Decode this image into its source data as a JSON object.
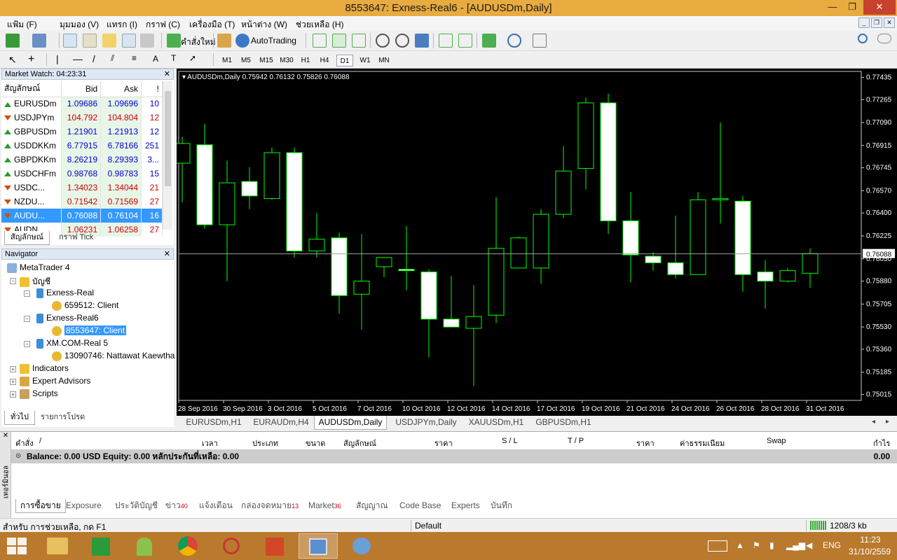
{
  "window": {
    "title": "8553647: Exness-Real6 - [AUDUSDm,Daily]",
    "min_glyph": "—",
    "max_glyph": "❐",
    "close_glyph": "✕"
  },
  "menu": [
    "แฟ้ม (F)",
    "มุมมอง (V)",
    "แทรก (I)",
    "กราฟ (C)",
    "เครื่องมือ (T)",
    "หน้าต่าง (W)",
    "ช่วยเหลือ (H)"
  ],
  "toolbar": {
    "new_order_label": "คำสั่งใหม่",
    "autotrading_label": "AutoTrading"
  },
  "timeframes": [
    "M1",
    "M5",
    "M15",
    "M30",
    "H1",
    "H4",
    "D1",
    "W1",
    "MN"
  ],
  "active_timeframe": "D1",
  "market_watch": {
    "title": "Market Watch: 04:23:31",
    "headers": {
      "symbol": "สัญลักษณ์",
      "bid": "Bid",
      "ask": "Ask",
      "spread": "!"
    },
    "rows": [
      {
        "symbol": "EURUSDm",
        "bid": "1.09686",
        "ask": "1.09696",
        "spread": "10",
        "dir": "up",
        "color": "blue"
      },
      {
        "symbol": "USDJPYm",
        "bid": "104.792",
        "ask": "104.804",
        "spread": "12",
        "dir": "down",
        "color": "red"
      },
      {
        "symbol": "GBPUSDm",
        "bid": "1.21901",
        "ask": "1.21913",
        "spread": "12",
        "dir": "up",
        "color": "blue"
      },
      {
        "symbol": "USDDKKm",
        "bid": "6.77915",
        "ask": "6.78166",
        "spread": "251",
        "dir": "up",
        "color": "blue"
      },
      {
        "symbol": "GBPDKKm",
        "bid": "8.26219",
        "ask": "8.29393",
        "spread": "3...",
        "dir": "up",
        "color": "blue"
      },
      {
        "symbol": "USDCHFm",
        "bid": "0.98768",
        "ask": "0.98783",
        "spread": "15",
        "dir": "up",
        "color": "blue"
      },
      {
        "symbol": "USDC...",
        "bid": "1.34023",
        "ask": "1.34044",
        "spread": "21",
        "dir": "down",
        "color": "red"
      },
      {
        "symbol": "NZDU...",
        "bid": "0.71542",
        "ask": "0.71569",
        "spread": "27",
        "dir": "down",
        "color": "red"
      },
      {
        "symbol": "AUDU...",
        "bid": "0.76088",
        "ask": "0.76104",
        "spread": "16",
        "dir": "down",
        "color": "blue",
        "selected": true
      },
      {
        "symbol": "AUDN...",
        "bid": "1.06231",
        "ask": "1.06258",
        "spread": "27",
        "dir": "down",
        "color": "red"
      }
    ],
    "tabs": [
      "สัญลักษณ์",
      "กราฟ Tick"
    ]
  },
  "navigator": {
    "title": "Navigator",
    "root": "MetaTrader 4",
    "accounts_label": "บัญชี",
    "servers": [
      {
        "name": "Exness-Real",
        "client": "659512: Client"
      },
      {
        "name": "Exness-Real6",
        "client": "8553647: Client"
      },
      {
        "name": "XM.COM-Real 5",
        "client": "13090746: Nattawat Kaewtha"
      }
    ],
    "indicators": "Indicators",
    "experts": "Expert Advisors",
    "scripts": "Scripts",
    "tabs": [
      "ทั่วไป",
      "รายการโปรด"
    ]
  },
  "chart_tabs": [
    "EURUSDm,H1",
    "EURAUDm,H4",
    "AUDUSDm,Daily",
    "USDJPYm,Daily",
    "XAUUSDm,H1",
    "GBPUSDm,H1"
  ],
  "active_chart_tab": 2,
  "chart_data": {
    "type": "candlestick",
    "symbol_label": "AUDUSDm,Daily",
    "ohlc_label": "0.75942 0.76132 0.75826 0.76088",
    "price_ticks": [
      "0.77435",
      "0.77265",
      "0.77090",
      "0.76915",
      "0.76745",
      "0.76570",
      "0.76400",
      "0.76225",
      "0.76050",
      "0.75880",
      "0.75705",
      "0.75530",
      "0.75360",
      "0.75185",
      "0.75015"
    ],
    "current_price": "0.76088",
    "date_labels": [
      "28 Sep 2016",
      "30 Sep 2016",
      "3 Oct 2016",
      "5 Oct 2016",
      "7 Oct 2016",
      "10 Oct 2016",
      "12 Oct 2016",
      "14 Oct 2016",
      "17 Oct 2016",
      "19 Oct 2016",
      "21 Oct 2016",
      "24 Oct 2016",
      "26 Oct 2016",
      "28 Oct 2016",
      "31 Oct 2016"
    ],
    "ylim": [
      0.7497,
      0.7748
    ],
    "candles": [
      {
        "o": 0.7678,
        "h": 0.7698,
        "l": 0.7648,
        "c": 0.7693
      },
      {
        "o": 0.7692,
        "h": 0.7708,
        "l": 0.7628,
        "c": 0.7631
      },
      {
        "o": 0.7631,
        "h": 0.768,
        "l": 0.7588,
        "c": 0.7663
      },
      {
        "o": 0.7664,
        "h": 0.7675,
        "l": 0.7643,
        "c": 0.7653
      },
      {
        "o": 0.7651,
        "h": 0.769,
        "l": 0.765,
        "c": 0.7686
      },
      {
        "o": 0.7686,
        "h": 0.769,
        "l": 0.7606,
        "c": 0.7611
      },
      {
        "o": 0.7611,
        "h": 0.764,
        "l": 0.7606,
        "c": 0.762
      },
      {
        "o": 0.7621,
        "h": 0.7625,
        "l": 0.7563,
        "c": 0.7577
      },
      {
        "o": 0.7578,
        "h": 0.7624,
        "l": 0.7551,
        "c": 0.7588
      },
      {
        "o": 0.7599,
        "h": 0.7605,
        "l": 0.7591,
        "c": 0.7606
      },
      {
        "o": 0.7597,
        "h": 0.763,
        "l": 0.7581,
        "c": 0.7596
      },
      {
        "o": 0.7595,
        "h": 0.7597,
        "l": 0.753,
        "c": 0.7559
      },
      {
        "o": 0.7559,
        "h": 0.7592,
        "l": 0.7553,
        "c": 0.7553
      },
      {
        "o": 0.7552,
        "h": 0.7585,
        "l": 0.7508,
        "c": 0.7561
      },
      {
        "o": 0.7562,
        "h": 0.7652,
        "l": 0.7556,
        "c": 0.7613
      },
      {
        "o": 0.7598,
        "h": 0.7622,
        "l": 0.7598,
        "c": 0.7621
      },
      {
        "o": 0.7598,
        "h": 0.7643,
        "l": 0.7586,
        "c": 0.7639
      },
      {
        "o": 0.7639,
        "h": 0.7691,
        "l": 0.7636,
        "c": 0.7672
      },
      {
        "o": 0.7674,
        "h": 0.7728,
        "l": 0.7658,
        "c": 0.7724
      },
      {
        "o": 0.7724,
        "h": 0.7731,
        "l": 0.7624,
        "c": 0.7634
      },
      {
        "o": 0.7634,
        "h": 0.7656,
        "l": 0.7587,
        "c": 0.7608
      },
      {
        "o": 0.7607,
        "h": 0.761,
        "l": 0.7596,
        "c": 0.7602
      },
      {
        "o": 0.7602,
        "h": 0.7638,
        "l": 0.759,
        "c": 0.7593
      },
      {
        "o": 0.7593,
        "h": 0.7656,
        "l": 0.7593,
        "c": 0.765
      },
      {
        "o": 0.765,
        "h": 0.7709,
        "l": 0.7632,
        "c": 0.7651
      },
      {
        "o": 0.7649,
        "h": 0.7653,
        "l": 0.758,
        "c": 0.7593
      },
      {
        "o": 0.7595,
        "h": 0.7604,
        "l": 0.7567,
        "c": 0.7588
      },
      {
        "o": 0.7588,
        "h": 0.7598,
        "l": 0.7587,
        "c": 0.7596
      },
      {
        "o": 0.7594,
        "h": 0.7613,
        "l": 0.7583,
        "c": 0.7609
      }
    ]
  },
  "terminal": {
    "side_label": "เทอร์มินอล",
    "headers": [
      "คำสั่ง",
      "/",
      "เวลา",
      "ประเภท",
      "ขนาด",
      "สัญลักษณ์",
      "ราคา",
      "S / L",
      "T / P",
      "ราคา",
      "ค่าธรรมเนียม",
      "Swap",
      "กำไร"
    ],
    "balance_text": "Balance: 0.00 USD  Equity: 0.00  หลักประกันที่เหลือ: 0.00",
    "balance_profit": "0.00",
    "tabs": [
      {
        "label": "การซื้อขาย",
        "count": ""
      },
      {
        "label": "Exposure",
        "count": ""
      },
      {
        "label": "ประวัติบัญชี",
        "count": ""
      },
      {
        "label": "ข่าว",
        "count": "40"
      },
      {
        "label": "แจ้งเตือน",
        "count": ""
      },
      {
        "label": "กล่องจดหมาย",
        "count": "13"
      },
      {
        "label": "Market",
        "count": "36"
      },
      {
        "label": "สัญญาณ",
        "count": ""
      },
      {
        "label": "Code Base",
        "count": ""
      },
      {
        "label": "Experts",
        "count": ""
      },
      {
        "label": "บันทึก",
        "count": ""
      }
    ]
  },
  "status": {
    "help": "สำหรับ การช่วยเหลือ, กด F1",
    "profile": "Default",
    "traffic": "1208/3 kb"
  },
  "taskbar": {
    "lang": "ENG",
    "time": "11:23",
    "date": "31/10/2559"
  }
}
